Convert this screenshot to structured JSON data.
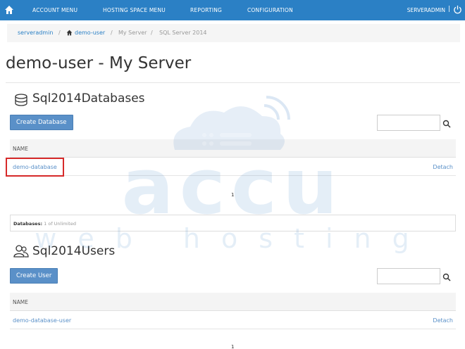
{
  "nav": {
    "items": [
      "ACCOUNT MENU",
      "HOSTING SPACE MENU",
      "REPORTING",
      "CONFIGURATION"
    ],
    "user": "SERVERADMIN",
    "separator": "|"
  },
  "breadcrumb": {
    "items": [
      "serveradmin",
      "demo-user",
      "My Server",
      "SQL Server 2014"
    ],
    "sep": "/"
  },
  "page_title": "demo-user - My Server",
  "databases": {
    "title": "Sql2014Databases",
    "create_button": "Create Database",
    "column": "NAME",
    "rows": [
      {
        "name": "demo-database",
        "action": "Detach"
      }
    ],
    "page": "1",
    "footer_label": "Databases:",
    "footer_value": "1 of Unlimited"
  },
  "users": {
    "title": "Sql2014Users",
    "create_button": "Create User",
    "column": "NAME",
    "rows": [
      {
        "name": "demo-database-user",
        "action": "Detach"
      }
    ],
    "page": "1"
  },
  "watermark": {
    "brand": "accu",
    "tagline": "web hosting"
  },
  "colors": {
    "nav": "#2b80c5",
    "button": "#5a90c8",
    "highlight": "#d62a2a",
    "link": "#5a90c8"
  }
}
